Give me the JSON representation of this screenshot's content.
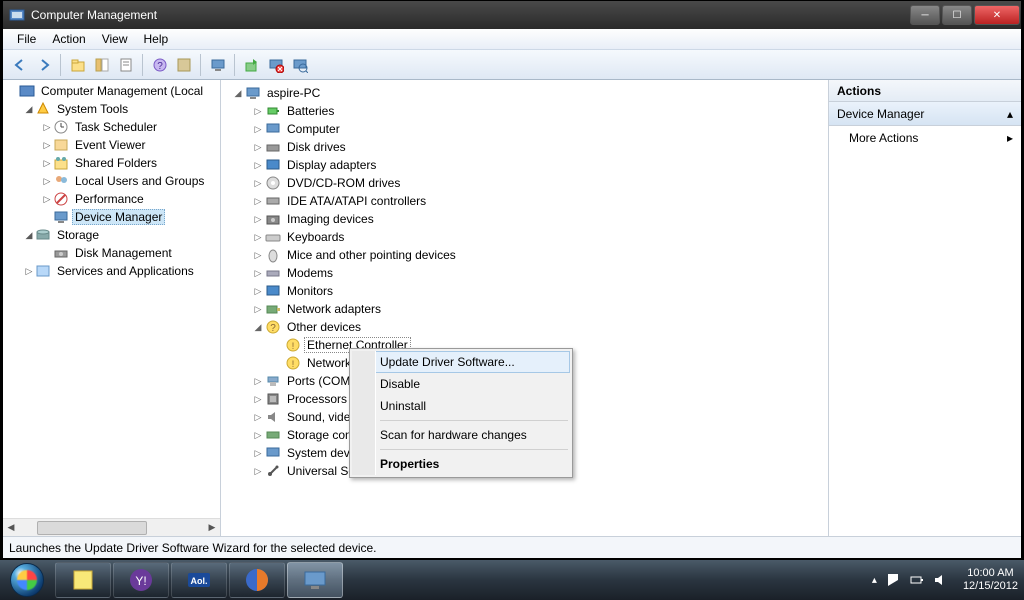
{
  "window": {
    "title": "Computer Management"
  },
  "menu": {
    "file": "File",
    "action": "Action",
    "view": "View",
    "help": "Help"
  },
  "left_tree": {
    "root": "Computer Management (Local",
    "system_tools": "System Tools",
    "task_scheduler": "Task Scheduler",
    "event_viewer": "Event Viewer",
    "shared_folders": "Shared Folders",
    "local_users": "Local Users and Groups",
    "performance": "Performance",
    "device_manager": "Device Manager",
    "storage": "Storage",
    "disk_management": "Disk Management",
    "services": "Services and Applications"
  },
  "mid_tree": {
    "root": "aspire-PC",
    "batteries": "Batteries",
    "computer": "Computer",
    "disk_drives": "Disk drives",
    "display_adapters": "Display adapters",
    "dvd": "DVD/CD-ROM drives",
    "ide": "IDE ATA/ATAPI controllers",
    "imaging": "Imaging devices",
    "keyboards": "Keyboards",
    "mice": "Mice and other pointing devices",
    "modems": "Modems",
    "monitors": "Monitors",
    "network_adapters": "Network adapters",
    "other_devices": "Other devices",
    "ethernet_controller": "Ethernet Controller",
    "network_truncated": "Network",
    "ports": "Ports (COM ",
    "processors": "Processors",
    "sound": "Sound, video",
    "storage_ctrl": "Storage cont",
    "system_dev": "System devic",
    "usb": "Universal Ser"
  },
  "context": {
    "update": "Update Driver Software...",
    "disable": "Disable",
    "uninstall": "Uninstall",
    "scan": "Scan for hardware changes",
    "properties": "Properties"
  },
  "actions": {
    "header": "Actions",
    "section": "Device Manager",
    "more": "More Actions"
  },
  "status": "Launches the Update Driver Software Wizard for the selected device.",
  "tray": {
    "time": "10:00 AM",
    "date": "12/15/2012"
  }
}
